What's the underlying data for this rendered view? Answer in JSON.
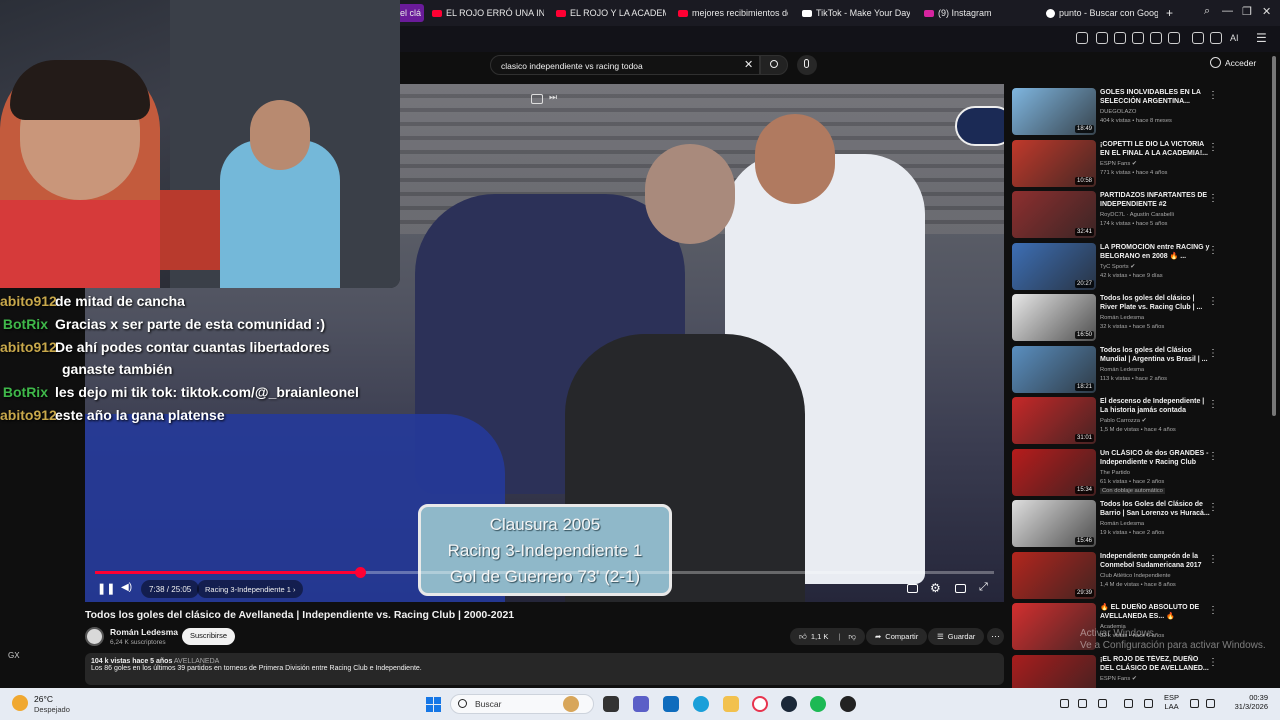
{
  "browser": {
    "tabs": [
      {
        "label": "el clá",
        "active": true
      },
      {
        "label": "EL ROJO ERRÓ UNA INC",
        "icon": "youtube-icon"
      },
      {
        "label": "EL ROJO Y LA ACADEM",
        "icon": "youtube-icon"
      },
      {
        "label": "mejores recibimientos de",
        "icon": "youtube-icon"
      },
      {
        "label": "TikTok - Make Your Day",
        "icon": "tiktok-icon"
      },
      {
        "label": "(9) Instagram",
        "icon": "instagram-icon"
      },
      {
        "label": "punto - Buscar con Goog",
        "icon": "google-icon"
      }
    ],
    "new_tab": "+",
    "ai_label": "AI"
  },
  "youtube": {
    "search_value": "clasico independiente vs racing todoa",
    "sign_in": "Acceder"
  },
  "video": {
    "scoreboard": [
      "Clausura 2005",
      "Racing 3-Independiente 1",
      "Gol de Guerrero 73' (2-1)"
    ],
    "progress": 0.295,
    "time": "7:38 / 25:05",
    "chapter": "Racing 3-Independiente 1 ›",
    "title": "Todos los goles del clásico de Avellaneda | Independiente vs. Racing Club | 2000-2021",
    "channel": "Román Ledesma",
    "subscribers": "6,24 K suscriptores",
    "subscribe": "Suscribirse",
    "likes": "1,1 K",
    "share": "Compartir",
    "save": "Guardar",
    "views_line": "104 k vistas  hace 5 años",
    "tag": "AVELLANEDA",
    "description": "Los 86 goles en los últimos 39 partidos en torneos de Primera División entre Racing Club e Independiente."
  },
  "chat": [
    {
      "user": "abito912",
      "color": "#c8a84b",
      "msg": "de mitad de cancha"
    },
    {
      "user": "BotRix",
      "color": "#3fb84a",
      "msg": "Gracias x ser parte de esta comunidad :)"
    },
    {
      "user": "abito912",
      "color": "#c8a84b",
      "msg": "De ahí podes contar cuantas libertadores",
      "cont": "ganaste también"
    },
    {
      "user": "BotRix",
      "color": "#3fb84a",
      "msg": "les dejo mi tik tok: tiktok.com/@_braianleonel"
    },
    {
      "user": "abito912",
      "color": "#c8a84b",
      "msg": "este año la gana platense"
    }
  ],
  "recommendations": [
    {
      "title": "GOLES INOLVIDABLES EN LA SELECCIÓN ARGENTINA...",
      "channel": "DUEGOLAZO",
      "meta": "404 k vistas • hace 8 meses",
      "duration": "18:49",
      "color": "#7fb6e0"
    },
    {
      "title": "¡COPETTI LE DIO LA VICTORIA EN EL FINAL A LA ACADEMIA!...",
      "channel": "ESPN Fans ✔",
      "meta": "771 k vistas • hace 4 años",
      "duration": "10:58",
      "color": "#c0392b"
    },
    {
      "title": "PARTIDAZOS INFARTANTES DE INDEPENDIENTE #2",
      "channel": "RoyDC7L · Agustín Carabelli",
      "meta": "174 k vistas • hace 5 años",
      "duration": "32:41",
      "color": "#8e2f2f"
    },
    {
      "title": "LA PROMOCIÓN entre RACING y BELGRANO en 2008 🔥 ...",
      "channel": "TyC Sports ✔",
      "meta": "42 k vistas • hace 9 días",
      "duration": "20:27",
      "color": "#3d6fb5"
    },
    {
      "title": "Todos los goles del clásico | River Plate vs. Racing Club | ...",
      "channel": "Román Ledesma",
      "meta": "32 k vistas • hace 5 años",
      "duration": "16:50",
      "color": "#e8e8e8"
    },
    {
      "title": "Todos los goles del Clásico Mundial | Argentina vs Brasil | ...",
      "channel": "Román Ledesma",
      "meta": "113 k vistas • hace 2 años",
      "duration": "18:21",
      "color": "#5a8fc0"
    },
    {
      "title": "El descenso de Independiente | La historia jamás contada",
      "channel": "Pablo Carrozza ✔",
      "meta": "1,5 M de vistas • hace 4 años",
      "duration": "31:01",
      "color": "#c62828"
    },
    {
      "title": "Un CLÁSICO de dos GRANDES - Independiente v Racing Club",
      "channel": "The Partido",
      "meta": "61 k vistas • hace 2 años",
      "extra": "Con doblaje automático",
      "duration": "15:34",
      "color": "#b71c1c"
    },
    {
      "title": "Todos los Goles del Clásico de Barrio | San Lorenzo vs Huracá...",
      "channel": "Román Ledesma",
      "meta": "19 k vistas • hace 2 años",
      "duration": "15:46",
      "color": "#dedede"
    },
    {
      "title": "Independiente campeón de la Conmebol Sudamericana 2017",
      "channel": "Club Atlético Independiente",
      "meta": "1,4 M de vistas • hace 8 años",
      "duration": "29:39",
      "color": "#b3261e"
    },
    {
      "title": "🔥 EL DUEÑO ABSOLUTO DE AVELLANEDA ES... 🔥",
      "channel": "Academia",
      "meta": "82 k vistas • hace 6 años",
      "duration": "",
      "color": "#d32f2f"
    },
    {
      "title": "¡EL ROJO DE TÉVEZ, DUEÑO DEL CLÁSICO DE AVELLANED...",
      "channel": "ESPN Fans ✔",
      "meta": "",
      "duration": "",
      "color": "#a81d1d"
    }
  ],
  "overlay": {
    "gx": "GX",
    "activate_line1": "Activar Windows",
    "activate_line2": "Ve a Configuración para activar Windows."
  },
  "taskbar": {
    "temp": "26°C",
    "weather": "Despejado",
    "search": "Buscar",
    "lang1": "ESP",
    "lang2": "LAA",
    "time": "00:39",
    "date": "31/3/2026"
  }
}
